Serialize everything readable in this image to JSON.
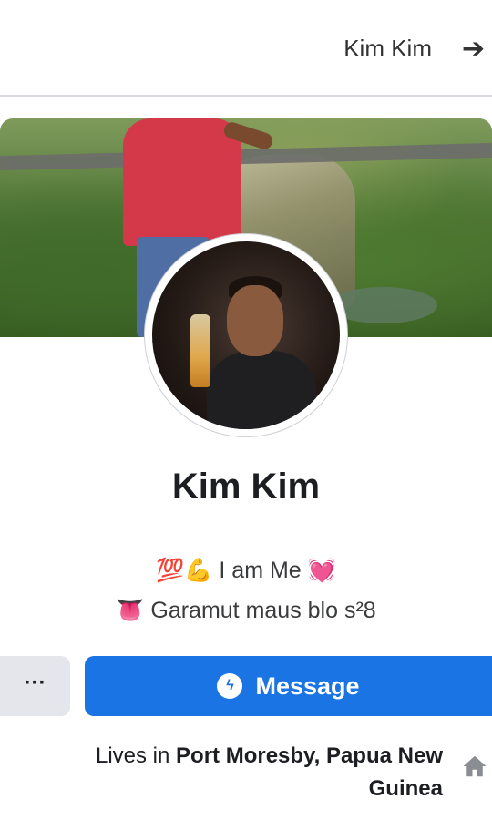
{
  "header": {
    "title": "Kim Kim",
    "back_icon": "arrow-icon"
  },
  "profile": {
    "name": "Kim Kim",
    "bio_line1": "💯💪 I am Me 💓",
    "bio_line2": "👅 Garamut maus blo s²8"
  },
  "actions": {
    "message_label": "Message",
    "more_label": "···"
  },
  "intro": {
    "lives_prefix": "Lives in ",
    "location": "Port Moresby, Papua New Guinea"
  },
  "colors": {
    "accent": "#1b74e4",
    "secondary_button": "#e4e6eb"
  }
}
